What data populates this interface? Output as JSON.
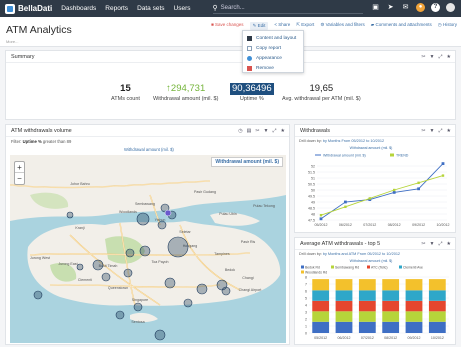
{
  "nav": {
    "logo": "BellaDati",
    "items": [
      "Dashboards",
      "Reports",
      "Data sets",
      "Users"
    ],
    "search_placeholder": "Search..."
  },
  "header": {
    "title": "ATM Analytics",
    "subtitle": "More...",
    "toolbar": {
      "save": "Save changes",
      "edit": "Edit",
      "share": "Share",
      "export": "Export",
      "variables": "Variables and filters",
      "comments": "Comments and attachments",
      "history": "History"
    }
  },
  "edit_menu": {
    "items": [
      {
        "label": "Content and layout",
        "icon": "layout-icon",
        "color": "#2f3a47"
      },
      {
        "label": "Copy report",
        "icon": "copy-icon",
        "color": "#8aa0b8"
      },
      {
        "label": "Appearance",
        "icon": "palette-icon",
        "color": "#3f8fd6"
      },
      {
        "label": "Remove",
        "icon": "trash-icon",
        "color": "#d9534f"
      }
    ]
  },
  "summary": {
    "title": "Summary",
    "kpis": [
      {
        "value": "15",
        "label": "ATMs count",
        "style": "bold"
      },
      {
        "value": "↑294,731",
        "label": "Withdrawal amount (mil. $)",
        "style": "green"
      },
      {
        "value": "90,36496",
        "label": "Uptime %",
        "style": "highlight"
      },
      {
        "value": "19,65",
        "label": "Avg. withdrawal per ATM (mil. $)",
        "style": "plain"
      }
    ]
  },
  "map_panel": {
    "title": "ATM withdrawals volume",
    "filter_prefix": "Filter:",
    "filter_bold": "Uptime %",
    "filter_rest": "greater than 89",
    "legend_top": "Withdrawal amount (mil. $)",
    "label_box": "Withdrawal amount (mil. $)",
    "zoom_in": "+",
    "zoom_out": "−",
    "places": [
      "Johor Bahru",
      "Pasir Gudang",
      "Woodlands",
      "Yishun",
      "Pulau Ubin",
      "Kranji",
      "Sembawang",
      "Seletar",
      "Hougang",
      "Tampines",
      "Pasir Ris",
      "Bedok",
      "Changi",
      "Jurong West",
      "Jurong East",
      "Bukit Timah",
      "Clementi",
      "Queenstown",
      "Singapore",
      "Sentosa",
      "Pulau Tekong",
      "Changi Airport",
      "Toa Payoh"
    ]
  },
  "withdrawals_panel": {
    "title": "Withdrawals",
    "drill_prefix": "Drill down by:",
    "drill_by": "by Months",
    "drill_range": "From 05/2012 to 10/2012",
    "legend_top": "Withdrawal amount (mil. $)",
    "series_names": [
      "Withdrawal amount (mil. $)",
      "TREND"
    ]
  },
  "top5_panel": {
    "title": "Average ATM withdrawals - top 5",
    "drill_prefix": "Drill down by:",
    "drill_by": "by Months and ATM",
    "drill_range": "From 05/2012 to 10/2012",
    "legend_top": "Withdrawal amount (mil. $)",
    "series_names": [
      "Bedok Rd",
      "Sembawang Rd",
      "ATC (Telic)",
      "Clementi Ave",
      "Woodlands Rd"
    ]
  },
  "colors": {
    "nav_bg": "#2f3a47",
    "accent": "#3f8fd6",
    "kpi_highlight": "#1f4f7f",
    "kpi_green": "#74b43a",
    "line_blue": "#3f6fc4",
    "line_green": "#b6d43a"
  },
  "chart_data": [
    {
      "type": "line",
      "title": "Withdrawals",
      "categories": [
        "05/2012",
        "06/2012",
        "07/2012",
        "08/2012",
        "09/2012",
        "10/2012"
      ],
      "series": [
        {
          "name": "Withdrawal amount (mil. $)",
          "values": [
            47.6,
            49.0,
            49.2,
            49.8,
            50.1,
            52.2
          ]
        },
        {
          "name": "TREND",
          "values": [
            47.9,
            48.6,
            49.3,
            50.0,
            50.6,
            51.2
          ]
        }
      ],
      "yticks": [
        47.5,
        48,
        48.5,
        49,
        49.5,
        50,
        50.5,
        51,
        51.5,
        52
      ],
      "ylim": [
        47.5,
        52.5
      ],
      "grid": true,
      "legend": "top"
    },
    {
      "type": "bar",
      "stacked": true,
      "title": "Average ATM withdrawals - top 5",
      "categories": [
        "05/2012",
        "06/2012",
        "07/2012",
        "08/2012",
        "09/2012",
        "10/2012"
      ],
      "series": [
        {
          "name": "Bedok Rd",
          "values": [
            1.6,
            1.6,
            1.6,
            1.6,
            1.6,
            1.6
          ],
          "color": "#3f6fc4"
        },
        {
          "name": "Sembawang Rd",
          "values": [
            1.5,
            1.5,
            1.5,
            1.5,
            1.5,
            1.5
          ],
          "color": "#b6d43a"
        },
        {
          "name": "ATC (Telic)",
          "values": [
            1.5,
            1.5,
            1.5,
            1.5,
            1.5,
            1.5
          ],
          "color": "#e5462e"
        },
        {
          "name": "Clementi Ave",
          "values": [
            1.5,
            1.5,
            1.5,
            1.5,
            1.5,
            1.5
          ],
          "color": "#2fa7c9"
        },
        {
          "name": "Woodlands Rd",
          "values": [
            1.6,
            1.6,
            1.6,
            1.6,
            1.6,
            1.6
          ],
          "color": "#f3c12c"
        }
      ],
      "yticks": [
        0,
        1,
        2,
        3,
        4,
        5,
        6,
        7,
        8
      ],
      "ylim": [
        0,
        8
      ],
      "grid": true,
      "legend": "top"
    }
  ]
}
